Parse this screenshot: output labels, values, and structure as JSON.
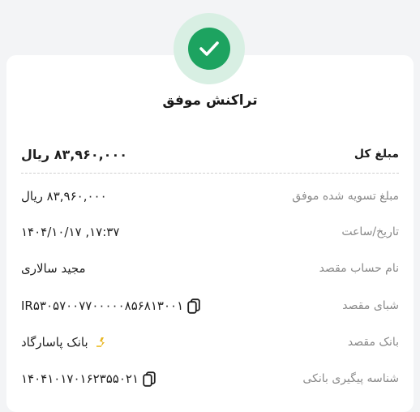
{
  "status": {
    "title": "تراکنش موفق",
    "icon": "check-icon",
    "color": "#1da360"
  },
  "rows": [
    {
      "label": "مبلغ کل",
      "value": "۸۳,۹۶۰,۰۰۰ ریال"
    },
    {
      "label": "مبلغ تسویه شده موفق",
      "value": "۸۳,۹۶۰,۰۰۰ ریال"
    },
    {
      "label": "تاریخ/ساعت",
      "value": "۱۴۰۴/۱۰/۱۷ ,۱۷:۳۷"
    },
    {
      "label": "نام حساب مقصد",
      "value": "مجید سالاری"
    },
    {
      "label": "شبای مقصد",
      "value": "IR۵۳۰۵۷۰۰۷۷۰۰۰۰۰۸۵۶۸۱۳۰۰۱"
    },
    {
      "label": "بانک مقصد",
      "value": "بانک پاسارگاد"
    },
    {
      "label": "شناسه پیگیری بانکی",
      "value": "۱۴۰۴۱۰۱۷۰۱۶۲۳۵۵۰۲۱"
    }
  ]
}
